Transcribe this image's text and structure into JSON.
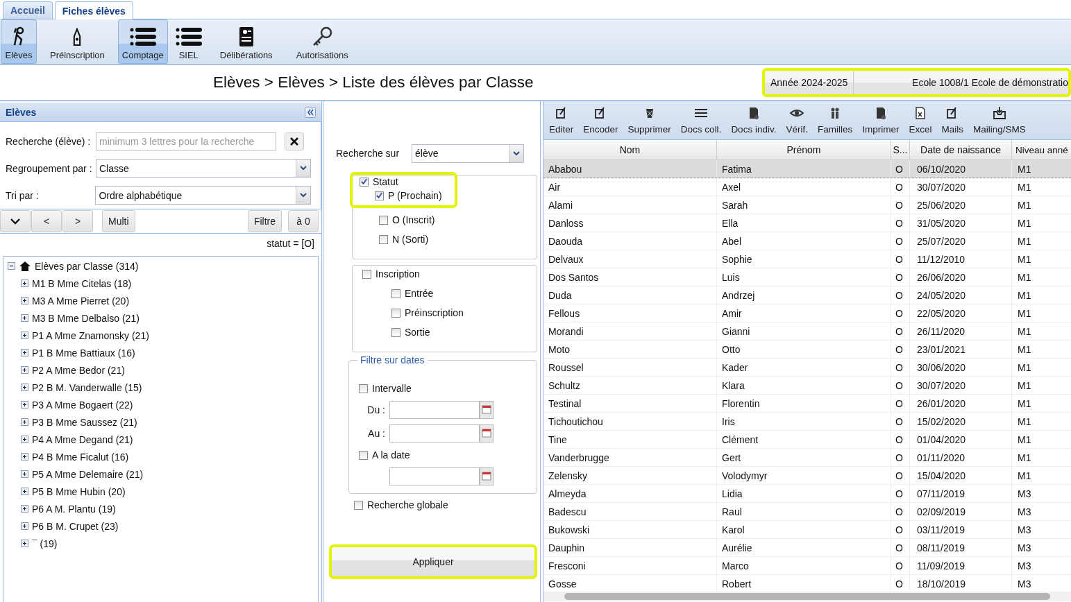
{
  "tabs": [
    {
      "label": "Accueil",
      "selected": false
    },
    {
      "label": "Fiches élèves",
      "selected": true
    }
  ],
  "ribbon": [
    {
      "label": "Elèves",
      "selected": true
    },
    {
      "label": "Préinscription",
      "selected": false
    },
    {
      "label": "Comptage",
      "selected": true
    },
    {
      "label": "SIEL",
      "selected": false
    },
    {
      "label": "Délibérations",
      "selected": false
    },
    {
      "label": "Autorisations",
      "selected": false
    }
  ],
  "breadcrumb": "Elèves > Elèves > Liste des élèves par Classe",
  "context": {
    "year": "Année 2024-2025",
    "school": "Ecole 1008/1 Ecole de démonstratio"
  },
  "left_panel": {
    "title": "Elèves",
    "search": {
      "label": "Recherche (élève) :",
      "placeholder": "minimum 3 lettres pour la recherche"
    },
    "grouping": {
      "label": "Regroupement par :",
      "value": "Classe"
    },
    "sort": {
      "label": "Tri par :",
      "value": "Ordre alphabétique"
    },
    "nav_buttons": [
      "<",
      ">",
      "Multi"
    ],
    "filter_buttons": [
      "Filtre",
      "à 0"
    ],
    "filter_summary": "statut = [O]",
    "tree": {
      "label": "Elèves par Classe (314)",
      "expanded": true,
      "children": [
        {
          "label": "M1 B Mme Citelas (18)",
          "expanded": false
        },
        {
          "label": "M3 A Mme Pierret (20)",
          "expanded": false
        },
        {
          "label": "M3 B Mme Delbalso (21)",
          "expanded": false
        },
        {
          "label": "P1 A Mme Znamonsky (21)",
          "expanded": false
        },
        {
          "label": "P1 B Mme Battiaux (16)",
          "expanded": false
        },
        {
          "label": "P2 A Mme Bedor (21)",
          "expanded": false
        },
        {
          "label": "P2 B M. Vanderwalle (15)",
          "expanded": false
        },
        {
          "label": "P3 A Mme Bogaert (22)",
          "expanded": false
        },
        {
          "label": "P3 B Mme Saussez (21)",
          "expanded": false
        },
        {
          "label": "P4 A Mme Degand (21)",
          "expanded": false
        },
        {
          "label": "P4 B Mme Ficalut (16)",
          "expanded": false
        },
        {
          "label": "P5 A Mme Delemaire (21)",
          "expanded": false
        },
        {
          "label": "P5 B Mme Hubin (20)",
          "expanded": false
        },
        {
          "label": "P6 A M. Plantu (19)",
          "expanded": false
        },
        {
          "label": "P6 B M. Crupet (23)",
          "expanded": false
        },
        {
          "label": "¯ (19)",
          "expanded": false
        }
      ]
    }
  },
  "filter_panel": {
    "search_on": {
      "label": "Recherche sur",
      "value": "élève"
    },
    "statut": {
      "label": "Statut",
      "checked": true,
      "options": [
        {
          "label": "P (Prochain)",
          "checked": true
        },
        {
          "label": "O (Inscrit)",
          "checked": false
        },
        {
          "label": "N (Sorti)",
          "checked": false
        }
      ]
    },
    "inscription": {
      "label": "Inscription",
      "checked": false,
      "options": [
        {
          "label": "Entrée",
          "checked": false
        },
        {
          "label": "Préinscription",
          "checked": false
        },
        {
          "label": "Sortie",
          "checked": false
        }
      ]
    },
    "dates": {
      "legend": "Filtre sur dates",
      "interval": {
        "label": "Intervalle",
        "checked": false
      },
      "from_label": "Du :",
      "to_label": "Au :",
      "on_date": {
        "label": "A la date",
        "checked": false
      }
    },
    "global_search": {
      "label": "Recherche globale",
      "checked": false
    },
    "apply": "Appliquer"
  },
  "toolbar": [
    "Editer",
    "Encoder",
    "Supprimer",
    "Docs coll.",
    "Docs indiv.",
    "Vérif.",
    "Familles",
    "Imprimer",
    "Excel",
    "Mails",
    "Mailing/SMS"
  ],
  "table": {
    "columns": [
      "Nom",
      "Prénom",
      "S...",
      "Date de naissance",
      "Niveau anné"
    ],
    "rows": [
      {
        "cells": [
          "Ababou",
          "Fatima",
          "O",
          "06/10/2020",
          "M1"
        ],
        "selected": true
      },
      {
        "cells": [
          "Air",
          "Axel",
          "O",
          "30/07/2020",
          "M1"
        ],
        "selected": false
      },
      {
        "cells": [
          "Alami",
          "Sarah",
          "O",
          "25/06/2020",
          "M1"
        ],
        "selected": false
      },
      {
        "cells": [
          "Danloss",
          "Ella",
          "O",
          "31/05/2020",
          "M1"
        ],
        "selected": false
      },
      {
        "cells": [
          "Daouda",
          "Abel",
          "O",
          "25/07/2020",
          "M1"
        ],
        "selected": false
      },
      {
        "cells": [
          "Delvaux",
          "Sophie",
          "O",
          "11/12/2010",
          "M1"
        ],
        "selected": false
      },
      {
        "cells": [
          "Dos Santos",
          "Luis",
          "O",
          "26/06/2020",
          "M1"
        ],
        "selected": false
      },
      {
        "cells": [
          "Duda",
          "Andrzej",
          "O",
          "24/05/2020",
          "M1"
        ],
        "selected": false
      },
      {
        "cells": [
          "Fellous",
          "Amir",
          "O",
          "22/05/2020",
          "M1"
        ],
        "selected": false
      },
      {
        "cells": [
          "Morandi",
          "Gianni",
          "O",
          "26/11/2020",
          "M1"
        ],
        "selected": false
      },
      {
        "cells": [
          "Moto",
          "Otto",
          "O",
          "23/01/2021",
          "M1"
        ],
        "selected": false
      },
      {
        "cells": [
          "Roussel",
          "Kader",
          "O",
          "30/06/2020",
          "M1"
        ],
        "selected": false
      },
      {
        "cells": [
          "Schultz",
          "Klara",
          "O",
          "30/07/2020",
          "M1"
        ],
        "selected": false
      },
      {
        "cells": [
          "Testinal",
          "Florentin",
          "O",
          "26/01/2020",
          "M1"
        ],
        "selected": false
      },
      {
        "cells": [
          "Tichoutichou",
          "Iris",
          "O",
          "15/02/2020",
          "M1"
        ],
        "selected": false
      },
      {
        "cells": [
          "Tine",
          "Clément",
          "O",
          "01/04/2020",
          "M1"
        ],
        "selected": false
      },
      {
        "cells": [
          "Vanderbrugge",
          "Gert",
          "O",
          "01/11/2020",
          "M1"
        ],
        "selected": false
      },
      {
        "cells": [
          "Zelensky",
          "Volodymyr",
          "O",
          "15/04/2020",
          "M1"
        ],
        "selected": false
      },
      {
        "cells": [
          "Almeyda",
          "Lidia",
          "O",
          "07/11/2019",
          "M3"
        ],
        "selected": false
      },
      {
        "cells": [
          "Badescu",
          "Raul",
          "O",
          "02/09/2019",
          "M3"
        ],
        "selected": false
      },
      {
        "cells": [
          "Bukowski",
          "Karol",
          "O",
          "03/11/2019",
          "M3"
        ],
        "selected": false
      },
      {
        "cells": [
          "Dauphin",
          "Aurélie",
          "O",
          "08/11/2019",
          "M3"
        ],
        "selected": false
      },
      {
        "cells": [
          "Fresconi",
          "Marco",
          "O",
          "11/09/2019",
          "M3"
        ],
        "selected": false
      },
      {
        "cells": [
          "Gosse",
          "Robert",
          "O",
          "18/10/2019",
          "M3"
        ],
        "selected": false
      }
    ]
  }
}
